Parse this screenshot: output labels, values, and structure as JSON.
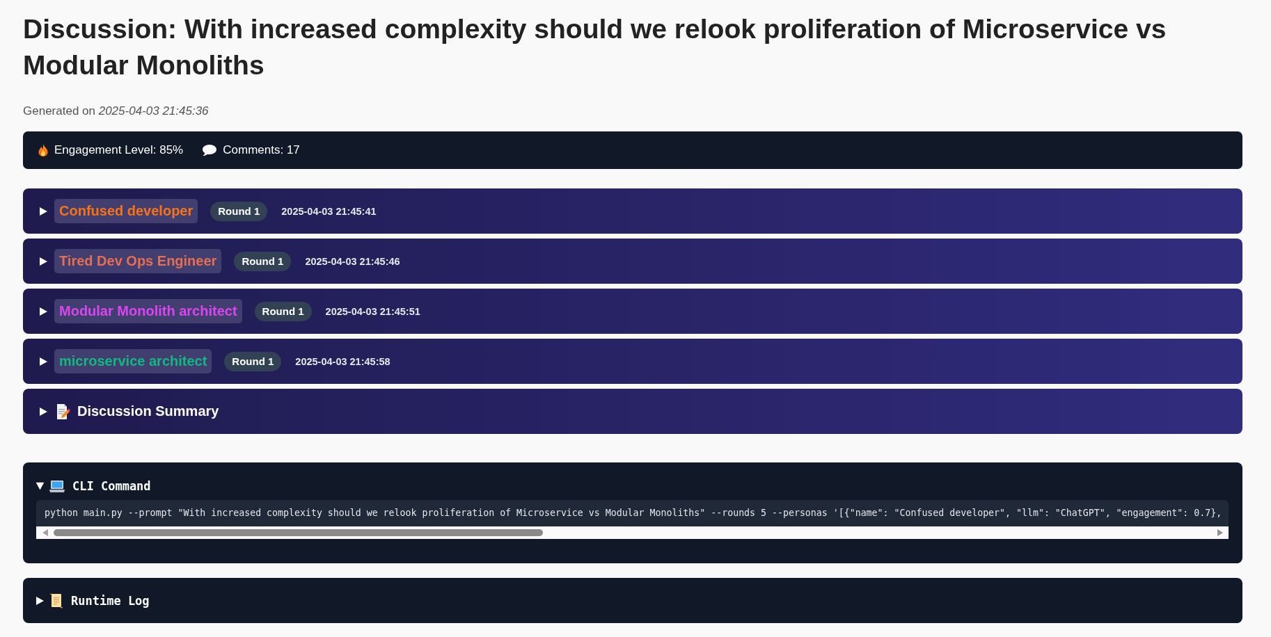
{
  "title": "Discussion: With increased complexity should we relook proliferation of Microservice vs Modular Monoliths",
  "generated": "Generated on *2025-04-03 21:45:36*",
  "stats": [
    {
      "kind": "engagement",
      "label": "Engagement Level: 85%"
    },
    {
      "kind": "comments",
      "label": "Comments: 17"
    }
  ],
  "messages": [
    {
      "persona": "Confused developer",
      "color": "#f97316",
      "round": "Round 1",
      "timestamp": "2025-04-03 21:45:41",
      "expanded": false
    },
    {
      "persona": "Tired Dev Ops Engineer",
      "color": "#e76f51",
      "round": "Round 1",
      "timestamp": "2025-04-03 21:45:46",
      "expanded": false
    },
    {
      "persona": "Modular Monolith architect",
      "color": "#d946ef",
      "round": "Round 1",
      "timestamp": "2025-04-03 21:45:51",
      "expanded": false
    },
    {
      "persona": "microservice architect",
      "color": "#10b981",
      "round": "Round 1",
      "timestamp": "2025-04-03 21:45:58",
      "expanded": false
    }
  ],
  "summary": {
    "title": "Discussion Summary",
    "expanded": false
  },
  "cli_command": {
    "title": "CLI Command",
    "expanded": true,
    "command": "python main.py --prompt \"With increased complexity should we relook proliferation of Microservice vs Modular Monoliths\" --rounds 5 --personas '[{\"name\": \"Confused developer\", \"llm\": \"ChatGPT\", \"engagement\": 0.7},"
  },
  "runtime_log": {
    "title": "Runtime Log",
    "expanded": false
  }
}
